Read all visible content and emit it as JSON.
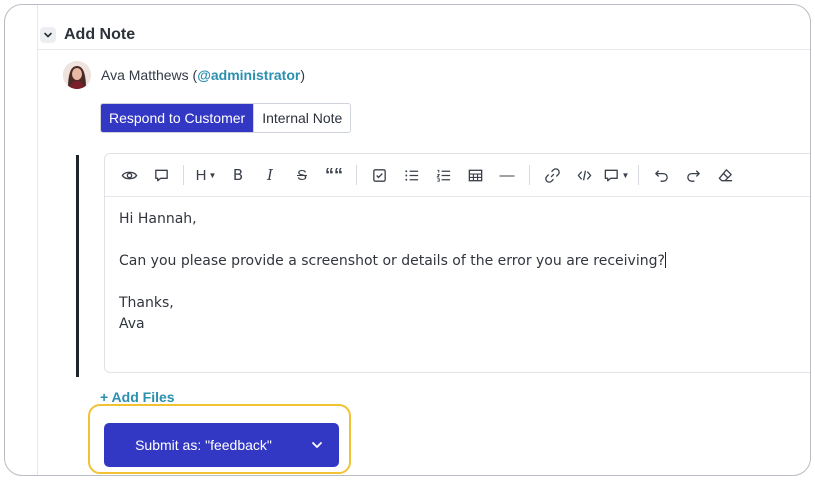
{
  "section": {
    "title": "Add Note"
  },
  "author": {
    "name": "Ava Matthews",
    "open": " (",
    "handle": "@administrator",
    "close": ")"
  },
  "tabs": [
    {
      "label": "Respond to Customer",
      "active": true
    },
    {
      "label": "Internal Note",
      "active": false
    }
  ],
  "toolbar": {
    "heading_label": "H",
    "bold_label": "B",
    "italic_label": "I",
    "strike_label": "S",
    "quote_label": "““",
    "hr_label": "—"
  },
  "editor": {
    "lines": [
      "Hi Hannah,",
      "",
      "Can you please provide a screenshot or details of the error you are receiving?",
      "",
      "Thanks,",
      "Ava"
    ]
  },
  "add_files": {
    "label": "+ Add Files"
  },
  "submit": {
    "label": "Submit as: \"feedback\""
  },
  "colors": {
    "primary": "#3338c4",
    "link": "#2b8fb0",
    "focus_ring": "#f1c232"
  }
}
